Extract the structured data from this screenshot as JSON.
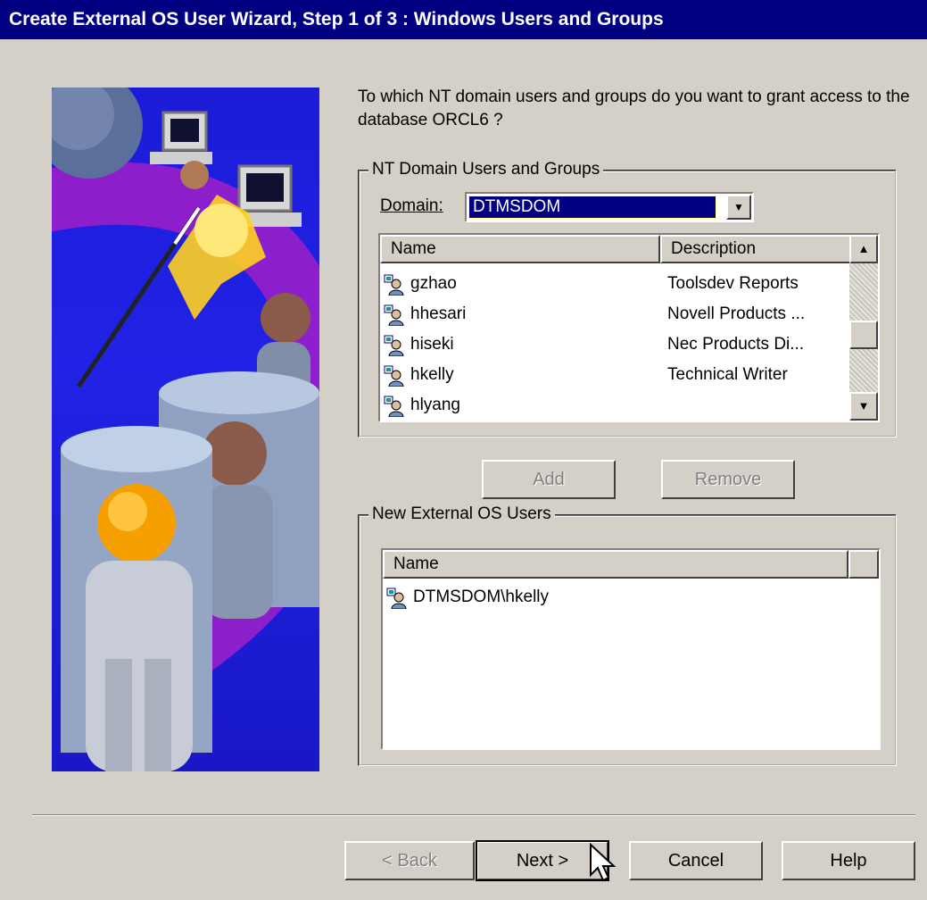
{
  "window": {
    "title": "Create External OS User Wizard, Step 1 of 3 : Windows Users and Groups"
  },
  "prompt": "To which NT domain users and groups do you want to grant access to the database ORCL6 ?",
  "domain_group": {
    "legend": "NT Domain Users and Groups",
    "domain_label": "Domain:",
    "domain_value": "DTMSDOM",
    "columns": [
      "Name",
      "Description"
    ],
    "rows": [
      {
        "name": "gzhao",
        "description": "Toolsdev Reports"
      },
      {
        "name": "hhesari",
        "description": "Novell Products ..."
      },
      {
        "name": "hiseki",
        "description": "Nec Products Di..."
      },
      {
        "name": "hkelly",
        "description": "Technical Writer"
      },
      {
        "name": "hlyang",
        "description": ""
      }
    ]
  },
  "actions": {
    "add_label": "Add",
    "remove_label": "Remove"
  },
  "new_users_group": {
    "legend": "New External OS Users",
    "columns": [
      "Name"
    ],
    "rows": [
      {
        "name": "DTMSDOM\\hkelly"
      }
    ]
  },
  "footer": {
    "back_label": "< Back",
    "next_label": "Next >",
    "cancel_label": "Cancel",
    "help_label": "Help"
  },
  "icons": [
    "user-group-icon",
    "dropdown-arrow-icon",
    "scroll-up-icon",
    "scroll-down-icon",
    "mouse-pointer-icon"
  ],
  "colors": {
    "title_bar": "#000080",
    "dialog_bg": "#d4d0c8",
    "selection": "#000080",
    "art_bg": "#2222e6"
  }
}
